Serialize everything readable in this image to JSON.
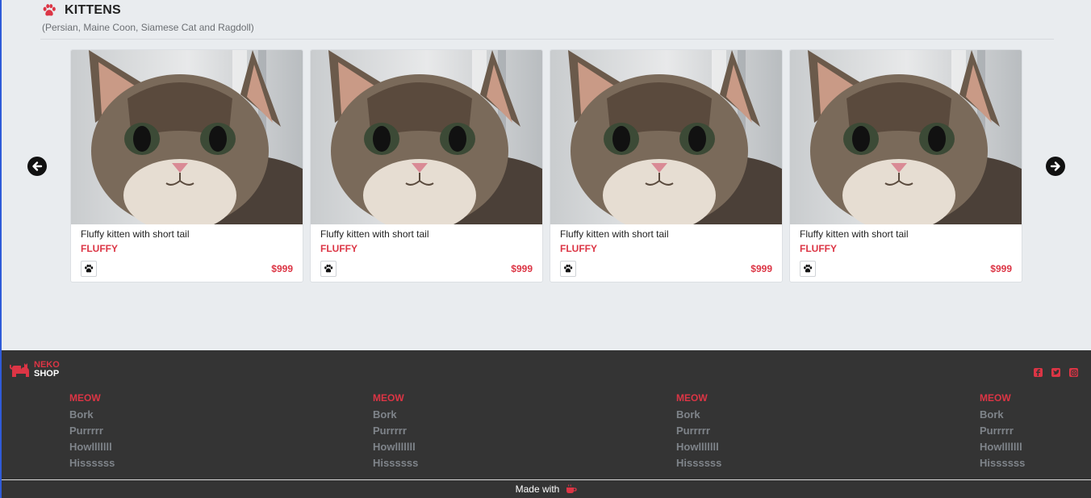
{
  "section": {
    "title": "KITTENS",
    "subtitle": "(Persian, Maine Coon, Siamese Cat and Ragdoll)"
  },
  "carousel": {
    "cards": [
      {
        "title": "Fluffy kitten with short tail",
        "tag": "FLUFFY",
        "price": "$999"
      },
      {
        "title": "Fluffy kitten with short tail",
        "tag": "FLUFFY",
        "price": "$999"
      },
      {
        "title": "Fluffy kitten with short tail",
        "tag": "FLUFFY",
        "price": "$999"
      },
      {
        "title": "Fluffy kitten with short tail",
        "tag": "FLUFFY",
        "price": "$999"
      }
    ]
  },
  "footer": {
    "brand": {
      "line1": "NEKO",
      "line2": "SHOP"
    },
    "columns": [
      {
        "head": "MEOW",
        "links": [
          "Bork",
          "Purrrrr",
          "Howlllllll",
          "Hissssss"
        ]
      },
      {
        "head": "MEOW",
        "links": [
          "Bork",
          "Purrrrr",
          "Howlllllll",
          "Hissssss"
        ]
      },
      {
        "head": "MEOW",
        "links": [
          "Bork",
          "Purrrrr",
          "Howlllllll",
          "Hissssss"
        ]
      },
      {
        "head": "MEOW",
        "links": [
          "Bork",
          "Purrrrr",
          "Howlllllll",
          "Hissssss"
        ]
      }
    ],
    "made_with": "Made with"
  },
  "colors": {
    "accent": "#dc3545",
    "footer_bg": "#343434",
    "page_bg": "#e9ecef"
  },
  "icons": {
    "title": "paw-icon",
    "prev": "arrow-left-circle-icon",
    "next": "arrow-right-circle-icon",
    "card": "paw-icon",
    "socials": [
      "facebook-icon",
      "twitter-icon",
      "instagram-icon"
    ],
    "made_with": "coffee-cup-icon"
  }
}
